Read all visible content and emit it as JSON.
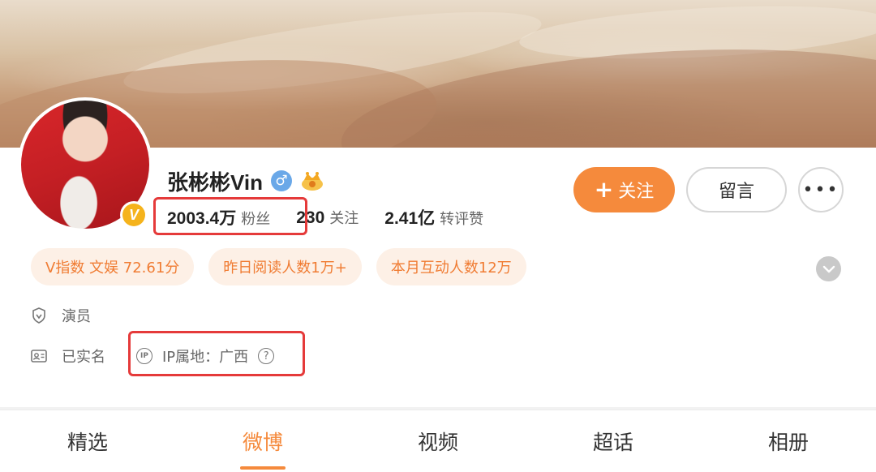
{
  "profile": {
    "name": "张彬彬Vin",
    "verified_badge": "V",
    "gender_icon": "male-icon",
    "level_icon": "crown-icon"
  },
  "stats": {
    "followers_count": "2003.4万",
    "followers_label": "粉丝",
    "following_count": "230",
    "following_label": "关注",
    "likes_count": "2.41亿",
    "likes_label": "转评赞"
  },
  "actions": {
    "follow_plus": "+",
    "follow_label": "关注",
    "message_label": "留言",
    "more_label": "•••"
  },
  "tags": [
    "V指数 文娱 72.61分",
    "昨日阅读人数1万+",
    "本月互动人数12万"
  ],
  "info": {
    "occupation": "演员",
    "verified_status": "已实名",
    "ip_icon_text": "IP",
    "ip_location": "IP属地：广西",
    "help_icon_text": "?"
  },
  "tabs": [
    {
      "label": "精选",
      "active": false
    },
    {
      "label": "微博",
      "active": true
    },
    {
      "label": "视频",
      "active": false
    },
    {
      "label": "超话",
      "active": false
    },
    {
      "label": "相册",
      "active": false
    }
  ],
  "colors": {
    "accent": "#f58a3c",
    "tag_bg": "#fdf0e6",
    "tag_text": "#f07c33",
    "highlight_box": "#e53a3a",
    "verified_gold": "#f5b31c",
    "gender_blue": "#6aa8e8"
  }
}
